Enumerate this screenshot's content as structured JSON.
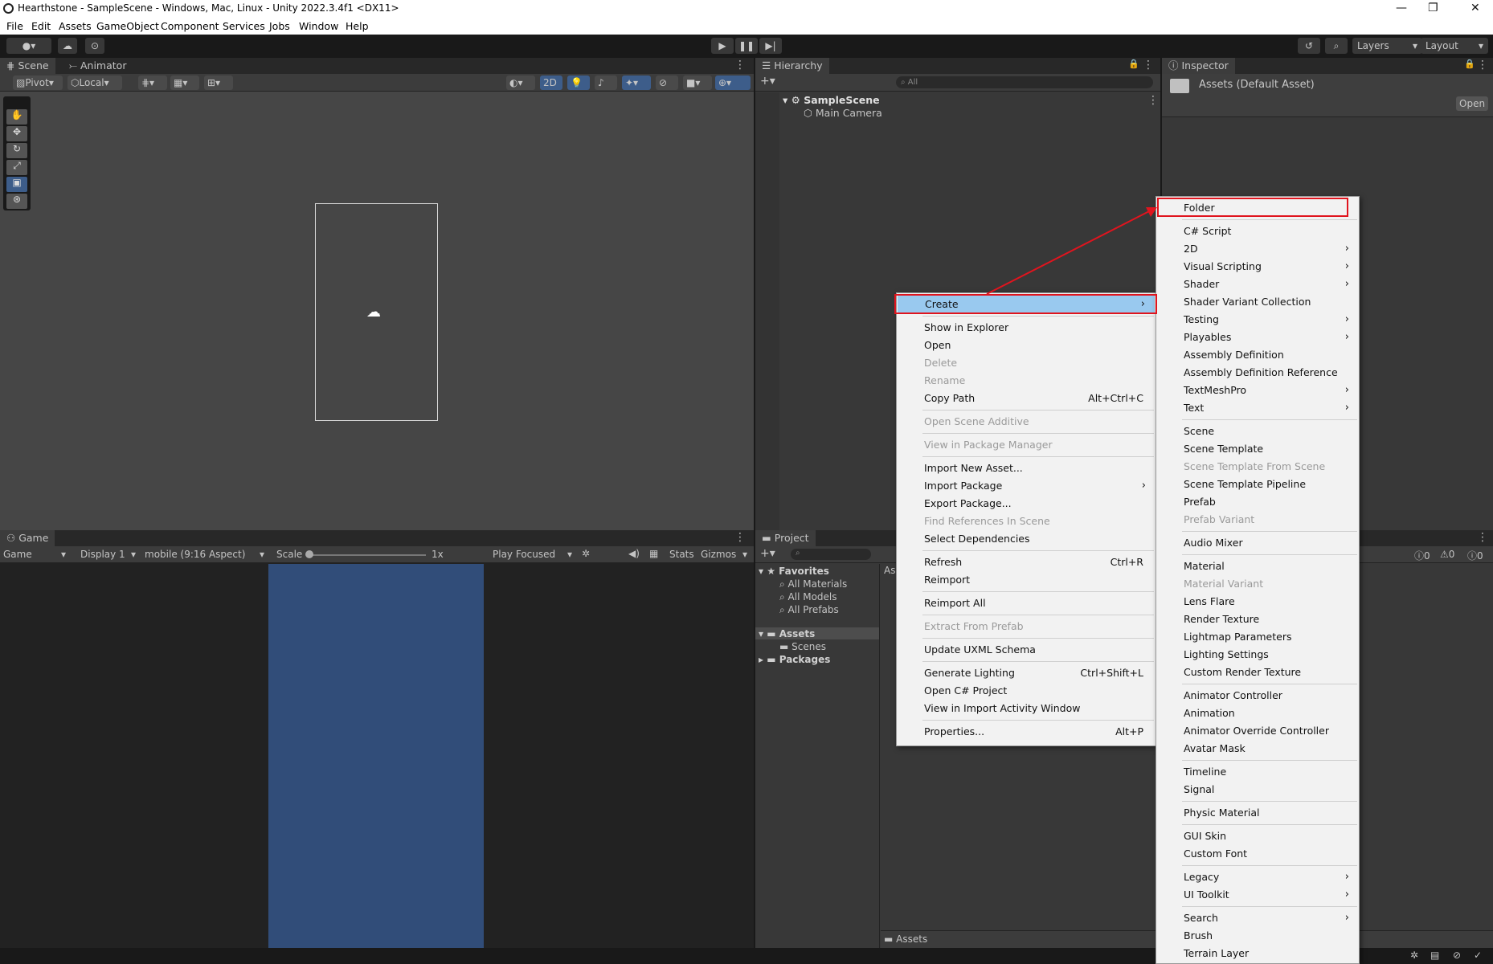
{
  "window": {
    "title": "Hearthstone - SampleScene - Windows, Mac, Linux - Unity 2022.3.4f1 <DX11>",
    "min": "—",
    "max": "❐",
    "close": "✕"
  },
  "menubar": [
    "File",
    "Edit",
    "Assets",
    "GameObject",
    "Component",
    "Services",
    "Jobs",
    "Window",
    "Help"
  ],
  "toolbar": {
    "layers": "Layers",
    "layout": "Layout"
  },
  "scene": {
    "tabs": [
      "Scene",
      "Animator"
    ],
    "pivot": "Pivot",
    "local": "Local",
    "mode2d": "2D"
  },
  "hierarchy": {
    "tab": "Hierarchy",
    "search_placeholder": "All",
    "scene": "SampleScene",
    "items": [
      "Main Camera"
    ]
  },
  "inspector": {
    "tab": "Inspector",
    "title": "Assets (Default Asset)",
    "open": "Open"
  },
  "game": {
    "tab": "Game",
    "game_dd": "Game",
    "display": "Display 1",
    "aspect": "mobile (9:16 Aspect)",
    "scale_label": "Scale",
    "scale_value": "1x",
    "play_focused": "Play Focused",
    "stats": "Stats",
    "gizmos": "Gizmos"
  },
  "project": {
    "tab": "Project",
    "favorites": "Favorites",
    "fav_items": [
      "All Materials",
      "All Models",
      "All Prefabs"
    ],
    "assets": "Assets",
    "scenes": "Scenes",
    "packages": "Packages",
    "breadcrumb": "Assets",
    "col_header": "As",
    "counts": [
      "0",
      "0",
      "0"
    ]
  },
  "context_menu": [
    {
      "label": "Create",
      "arrow": "›",
      "highlight": true
    },
    {
      "sep": true
    },
    {
      "label": "Show in Explorer"
    },
    {
      "label": "Open"
    },
    {
      "label": "Delete",
      "disabled": true
    },
    {
      "label": "Rename",
      "disabled": true
    },
    {
      "label": "Copy Path",
      "shortcut": "Alt+Ctrl+C"
    },
    {
      "sep": true
    },
    {
      "label": "Open Scene Additive",
      "disabled": true
    },
    {
      "sep": true
    },
    {
      "label": "View in Package Manager",
      "disabled": true
    },
    {
      "sep": true
    },
    {
      "label": "Import New Asset..."
    },
    {
      "label": "Import Package",
      "arrow": "›"
    },
    {
      "label": "Export Package..."
    },
    {
      "label": "Find References In Scene",
      "disabled": true
    },
    {
      "label": "Select Dependencies"
    },
    {
      "sep": true
    },
    {
      "label": "Refresh",
      "shortcut": "Ctrl+R"
    },
    {
      "label": "Reimport"
    },
    {
      "sep": true
    },
    {
      "label": "Reimport All"
    },
    {
      "sep": true
    },
    {
      "label": "Extract From Prefab",
      "disabled": true
    },
    {
      "sep": true
    },
    {
      "label": "Update UXML Schema"
    },
    {
      "sep": true
    },
    {
      "label": "Generate Lighting",
      "shortcut": "Ctrl+Shift+L"
    },
    {
      "label": "Open C# Project"
    },
    {
      "label": "View in Import Activity Window"
    },
    {
      "sep": true
    },
    {
      "label": "Properties...",
      "shortcut": "Alt+P"
    }
  ],
  "create_submenu": [
    {
      "label": "Folder",
      "boxed": true
    },
    {
      "sep": true
    },
    {
      "label": "C# Script"
    },
    {
      "label": "2D",
      "arrow": "›"
    },
    {
      "label": "Visual Scripting",
      "arrow": "›"
    },
    {
      "label": "Shader",
      "arrow": "›"
    },
    {
      "label": "Shader Variant Collection"
    },
    {
      "label": "Testing",
      "arrow": "›"
    },
    {
      "label": "Playables",
      "arrow": "›"
    },
    {
      "label": "Assembly Definition"
    },
    {
      "label": "Assembly Definition Reference"
    },
    {
      "label": "TextMeshPro",
      "arrow": "›"
    },
    {
      "label": "Text",
      "arrow": "›"
    },
    {
      "sep": true
    },
    {
      "label": "Scene"
    },
    {
      "label": "Scene Template"
    },
    {
      "label": "Scene Template From Scene",
      "disabled": true
    },
    {
      "label": "Scene Template Pipeline"
    },
    {
      "label": "Prefab"
    },
    {
      "label": "Prefab Variant",
      "disabled": true
    },
    {
      "sep": true
    },
    {
      "label": "Audio Mixer"
    },
    {
      "sep": true
    },
    {
      "label": "Material"
    },
    {
      "label": "Material Variant",
      "disabled": true
    },
    {
      "label": "Lens Flare"
    },
    {
      "label": "Render Texture"
    },
    {
      "label": "Lightmap Parameters"
    },
    {
      "label": "Lighting Settings"
    },
    {
      "label": "Custom Render Texture"
    },
    {
      "sep": true
    },
    {
      "label": "Animator Controller"
    },
    {
      "label": "Animation"
    },
    {
      "label": "Animator Override Controller"
    },
    {
      "label": "Avatar Mask"
    },
    {
      "sep": true
    },
    {
      "label": "Timeline"
    },
    {
      "label": "Signal"
    },
    {
      "sep": true
    },
    {
      "label": "Physic Material"
    },
    {
      "sep": true
    },
    {
      "label": "GUI Skin"
    },
    {
      "label": "Custom Font"
    },
    {
      "sep": true
    },
    {
      "label": "Legacy",
      "arrow": "›"
    },
    {
      "label": "UI Toolkit",
      "arrow": "›"
    },
    {
      "sep": true
    },
    {
      "label": "Search",
      "arrow": "›"
    },
    {
      "label": "Brush"
    },
    {
      "label": "Terrain Layer"
    }
  ],
  "colors": {
    "accent": "#99c9ef",
    "annotation": "#e0141e",
    "game_view": "#314d79",
    "panel": "#383838"
  }
}
